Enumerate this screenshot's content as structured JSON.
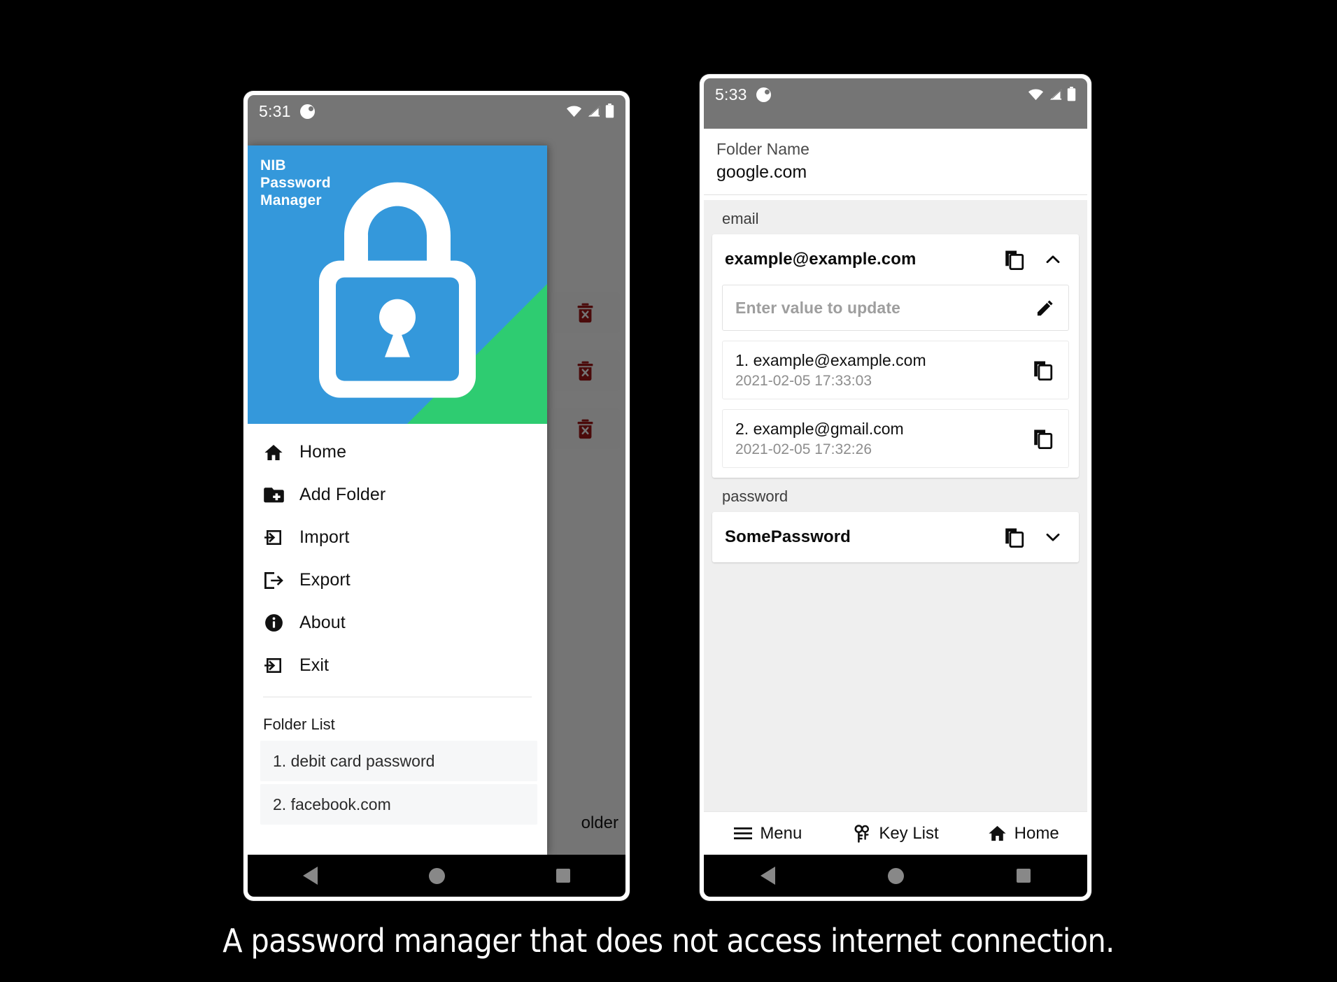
{
  "caption": "A password manager that does not access internet connection.",
  "colors": {
    "brand_blue": "#3498db",
    "brand_green": "#2ecc71",
    "status_bar_gray": "#757575",
    "delete_red": "#a31919",
    "body_gray": "#efefef"
  },
  "left_phone": {
    "status_bar": {
      "time": "5:31",
      "app_icon": "app-notification-icon",
      "wifi_icon": "wifi-icon",
      "signal_icon": "cell-signal-icon",
      "battery_icon": "battery-icon"
    },
    "backdrop": {
      "rows": [
        {
          "delete_icon": "delete-trash-icon"
        },
        {
          "delete_icon": "delete-trash-icon"
        },
        {
          "delete_icon": "delete-trash-icon"
        }
      ],
      "add_folder_partial": "older"
    },
    "drawer": {
      "header": {
        "title_lines": "NIB\nPassword\nManager",
        "title_line1": "NIB",
        "title_line2": "Password",
        "title_line3": "Manager",
        "logo_icon": "padlock-icon"
      },
      "menu": [
        {
          "label": "Home",
          "icon": "home-icon"
        },
        {
          "label": "Add Folder",
          "icon": "create-new-folder-icon"
        },
        {
          "label": "Import",
          "icon": "import-arrow-icon"
        },
        {
          "label": "Export",
          "icon": "export-arrow-icon"
        },
        {
          "label": "About",
          "icon": "info-icon"
        },
        {
          "label": "Exit",
          "icon": "exit-arrow-icon"
        }
      ],
      "folder_list_title": "Folder List",
      "folders": [
        {
          "label": "1. debit card password"
        },
        {
          "label": "2. facebook.com"
        }
      ]
    },
    "system_nav": {
      "back": "back-triangle-icon",
      "home": "home-circle-icon",
      "recents": "recents-square-icon"
    }
  },
  "right_phone": {
    "status_bar": {
      "time": "5:33",
      "app_icon": "app-notification-icon",
      "wifi_icon": "wifi-icon",
      "signal_icon": "cell-signal-icon",
      "battery_icon": "battery-icon"
    },
    "folder_name": {
      "label": "Folder Name",
      "value": "google.com"
    },
    "groups": [
      {
        "label": "email",
        "entry": {
          "value": "example@example.com",
          "copy_icon": "copy-icon",
          "expanded": true,
          "chevron_icon": "chevron-up-icon",
          "update_field": {
            "placeholder": "Enter value to update",
            "value": "",
            "edit_icon": "pencil-edit-icon"
          },
          "history": [
            {
              "value": "1. example@example.com",
              "timestamp": "2021-02-05 17:33:03",
              "copy_icon": "copy-icon"
            },
            {
              "value": "2. example@gmail.com",
              "timestamp": "2021-02-05 17:32:26",
              "copy_icon": "copy-icon"
            }
          ]
        }
      },
      {
        "label": "password",
        "entry": {
          "value": "SomePassword",
          "copy_icon": "copy-icon",
          "expanded": false,
          "chevron_icon": "chevron-down-icon"
        }
      }
    ],
    "bottom_tabs": [
      {
        "label": "Menu",
        "icon": "hamburger-menu-icon"
      },
      {
        "label": "Key List",
        "icon": "vpn-key-icon"
      },
      {
        "label": "Home",
        "icon": "home-icon"
      }
    ],
    "system_nav": {
      "back": "back-triangle-icon",
      "home": "home-circle-icon",
      "recents": "recents-square-icon"
    }
  }
}
